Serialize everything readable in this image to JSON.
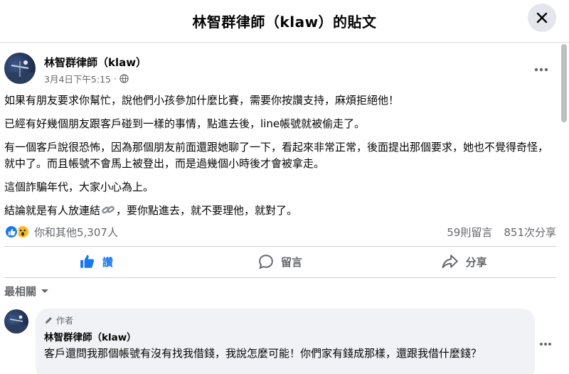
{
  "header": {
    "title": "林智群律師（klaw）的貼文",
    "close_icon": "close-icon"
  },
  "post": {
    "author": "林智群律師（klaw）",
    "timestamp": "3月4日下午5:15",
    "privacy_icon": "globe-icon",
    "paragraphs": [
      "如果有朋友要求你幫忙，說他們小孩參加什麼比賽，需要你按讚支持，麻煩拒絕他！",
      "已經有好幾個朋友跟客戶碰到一樣的事情，點進去後，line帳號就被偷走了。",
      "有一個客戶說很恐怖，因為那個朋友前面還跟她聊了一下，看起來非常正常，後面提出那個要求，她也不覺得奇怪，就中了。而且帳號不會馬上被登出，而是過幾個小時後才會被拿走。",
      "這個詐騙年代，大家小心為上。"
    ],
    "last_paragraph_before": "結論就是有人放連結",
    "last_paragraph_after": "，要你點進去，就不要理他，就對了。",
    "link_icon": "link-icon"
  },
  "reactions": {
    "summary": "你和其他5,307人",
    "comments": "59則留言",
    "shares": "851次分享",
    "icons": [
      "like-icon",
      "wow-icon"
    ]
  },
  "actions": {
    "like": "讚",
    "comment": "留言",
    "share": "分享"
  },
  "sort": {
    "label": "最相關"
  },
  "comment": {
    "badge": "作者",
    "author": "林智群律師（klaw）",
    "text": "客戶還問我那個帳號有沒有找我借錢，我說怎麼可能！你們家有錢成那樣，還跟我借什麼錢？"
  },
  "colors": {
    "accent": "#1877f2",
    "secondary_text": "#65676b",
    "bubble": "#f0f2f5"
  }
}
